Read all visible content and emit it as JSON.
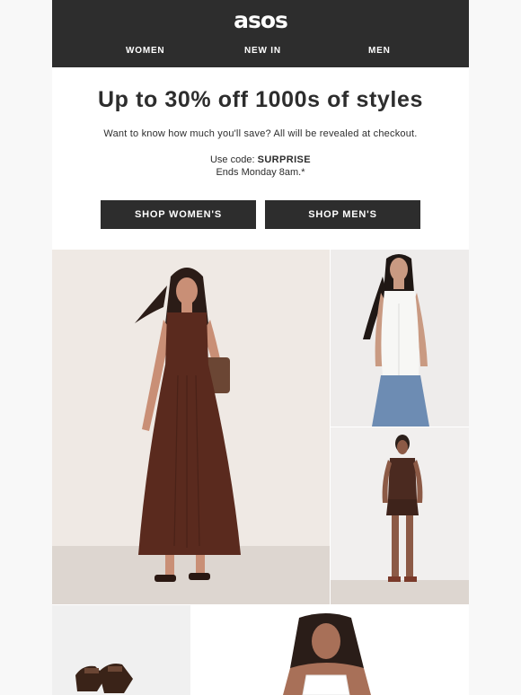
{
  "header": {
    "logo": "asos",
    "nav": [
      "WOMEN",
      "NEW IN",
      "MEN"
    ]
  },
  "hero": {
    "headline": "Up to 30% off 1000s of styles",
    "subtext": "Want to know how much you'll save? All will be revealed at checkout.",
    "code_prefix": "Use code: ",
    "code": "SURPRISE",
    "ends": "Ends Monday 8am.*",
    "buttons": {
      "women": "SHOP WOMEN'S",
      "men": "SHOP MEN'S"
    }
  },
  "colors": {
    "header_bg": "#2d2d2d",
    "button_bg": "#2d2d2d",
    "text": "#2d2d2d",
    "dress": "#5a2a1e"
  },
  "images": [
    "model-brown-maxi-dress-photo",
    "model-white-top-jeans-photo",
    "model-brown-waistcoat-shorts-photo",
    "brown-sandals-photo",
    "model-white-tank-photo"
  ]
}
